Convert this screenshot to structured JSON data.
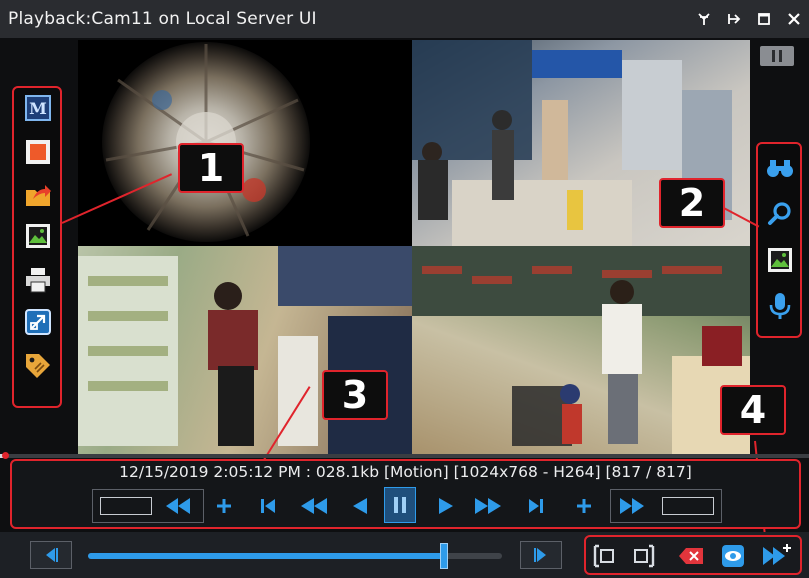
{
  "window": {
    "title": "Playback:Cam11 on Local Server UI",
    "buttons": [
      "pin",
      "detach",
      "maximize",
      "close"
    ]
  },
  "left_toolbar": {
    "badge": "1",
    "items": [
      {
        "name": "motion-icon",
        "label": "M"
      },
      {
        "name": "stop-record-icon"
      },
      {
        "name": "export-icon"
      },
      {
        "name": "snapshot-icon"
      },
      {
        "name": "print-icon"
      },
      {
        "name": "fullscreen-icon"
      },
      {
        "name": "tag-icon"
      }
    ]
  },
  "right_toolbar": {
    "badge": "2",
    "items": [
      {
        "name": "binoculars-icon"
      },
      {
        "name": "zoom-icon"
      },
      {
        "name": "image-icon"
      },
      {
        "name": "microphone-icon"
      }
    ]
  },
  "video": {
    "cells": [
      "fisheye view",
      "store aisle view",
      "refrigerator view",
      "checkout view"
    ],
    "badge_playback": "3",
    "badge_bottom": "4"
  },
  "playback": {
    "status_text": "12/15/2019 2:05:12 PM : 028.1kb [Motion] [1024x768 - H264] [817 / 817]",
    "progress": 0.01
  },
  "bottom": {
    "zoom_slider_value": 0.86
  },
  "colors": {
    "accent_red": "#e0242c",
    "control_blue": "#2e9bea"
  }
}
